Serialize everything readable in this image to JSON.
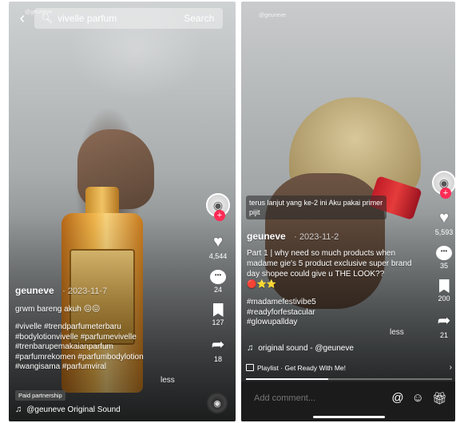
{
  "colors": {
    "accent": "#fe2c55",
    "comment_bar": "#1b1b1b"
  },
  "left": {
    "handle_top": "@geuneve",
    "search": {
      "query": "vivelle parfum",
      "button": "Search"
    },
    "rail": {
      "likes": "4,544",
      "comments": "24",
      "saves": "127",
      "shares": "18"
    },
    "author": "geuneve",
    "date": "· 2023-11-7",
    "description": "grwm bareng akuh 😖😖",
    "hashtags": [
      "#vivelle #trendparfumeterbaru",
      "#bodylotionvivelle #parfumevivelle",
      "#trenbarupemakaianparfum",
      "#parfumrekomen #parfumbodylotion",
      "#wangisama #parfumviral"
    ],
    "less": "less",
    "paid_partnership": "Paid partnership",
    "sound": "@geuneve Original Sound"
  },
  "right": {
    "handle_top": "@geuneve",
    "overlay_text": "terus lanjut yang ke-2 ini Aku pakai primer pijit",
    "rail": {
      "likes": "5,593",
      "comments": "35",
      "saves": "200",
      "shares": "21"
    },
    "author": "geuneve",
    "date": "· 2023-11-2",
    "description": "Part 1 | why need so much products when madame gie's 5 product exclusive super brand day shopee could give u THE LOOK?? 🔴⭐⭐",
    "hashtags": [
      "#madamefestivibe5",
      "#readyforfestacular",
      "#glowupallday"
    ],
    "less": "less",
    "sound": "original sound - @geuneve",
    "playlist": "Playlist · Get Ready With Me!",
    "progress": 0.4,
    "comment_placeholder": "Add comment..."
  }
}
